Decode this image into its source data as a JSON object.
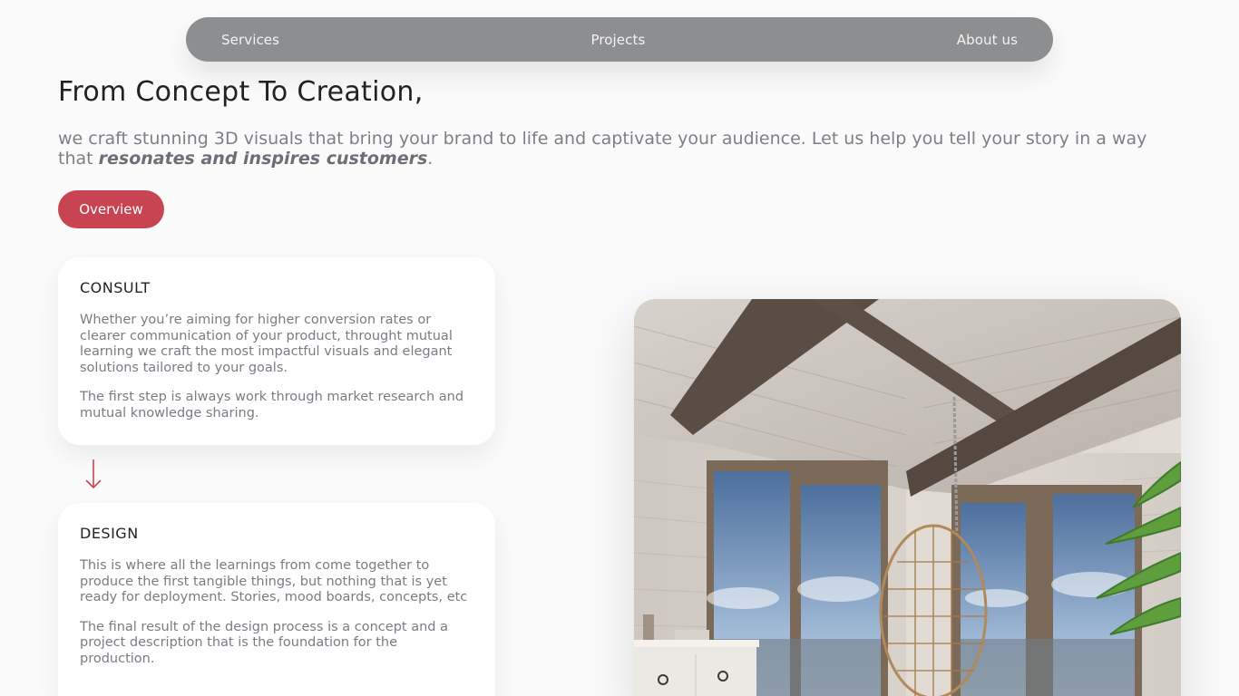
{
  "nav": {
    "items": [
      "Services",
      "Projects",
      "About us"
    ]
  },
  "hero": {
    "title": "From Concept To Creation,",
    "subtitle_start": "we craft stunning 3D visuals that bring your brand to life and captivate your audience. Let us help you tell your story in a way that ",
    "subtitle_emphasis": "resonates and inspires customers",
    "subtitle_end": "."
  },
  "overview_button": "Overview",
  "steps": [
    {
      "title": "CONSULT",
      "paragraphs": [
        "Whether you’re aiming for higher conversion rates or clearer communication of your product, throught mutual learning we craft the most impactful visuals and elegant solutions tailored to your goals.",
        "The first step is always work through market research and mutual knowledge sharing."
      ]
    },
    {
      "title": "DESIGN",
      "paragraphs": [
        "This is where all the learnings from come together to produce the first tangible things, but nothing that is yet ready for deployment. Stories, mood boards, concepts, etc",
        "The final result of the design process is a concept and a project description that is the foundation for the production."
      ]
    }
  ],
  "colors": {
    "accent": "#c94453",
    "nav_bg": "#8d8e90",
    "text_muted": "#7a7c84"
  },
  "icons": {
    "step_arrow": "arrow-down-icon"
  }
}
